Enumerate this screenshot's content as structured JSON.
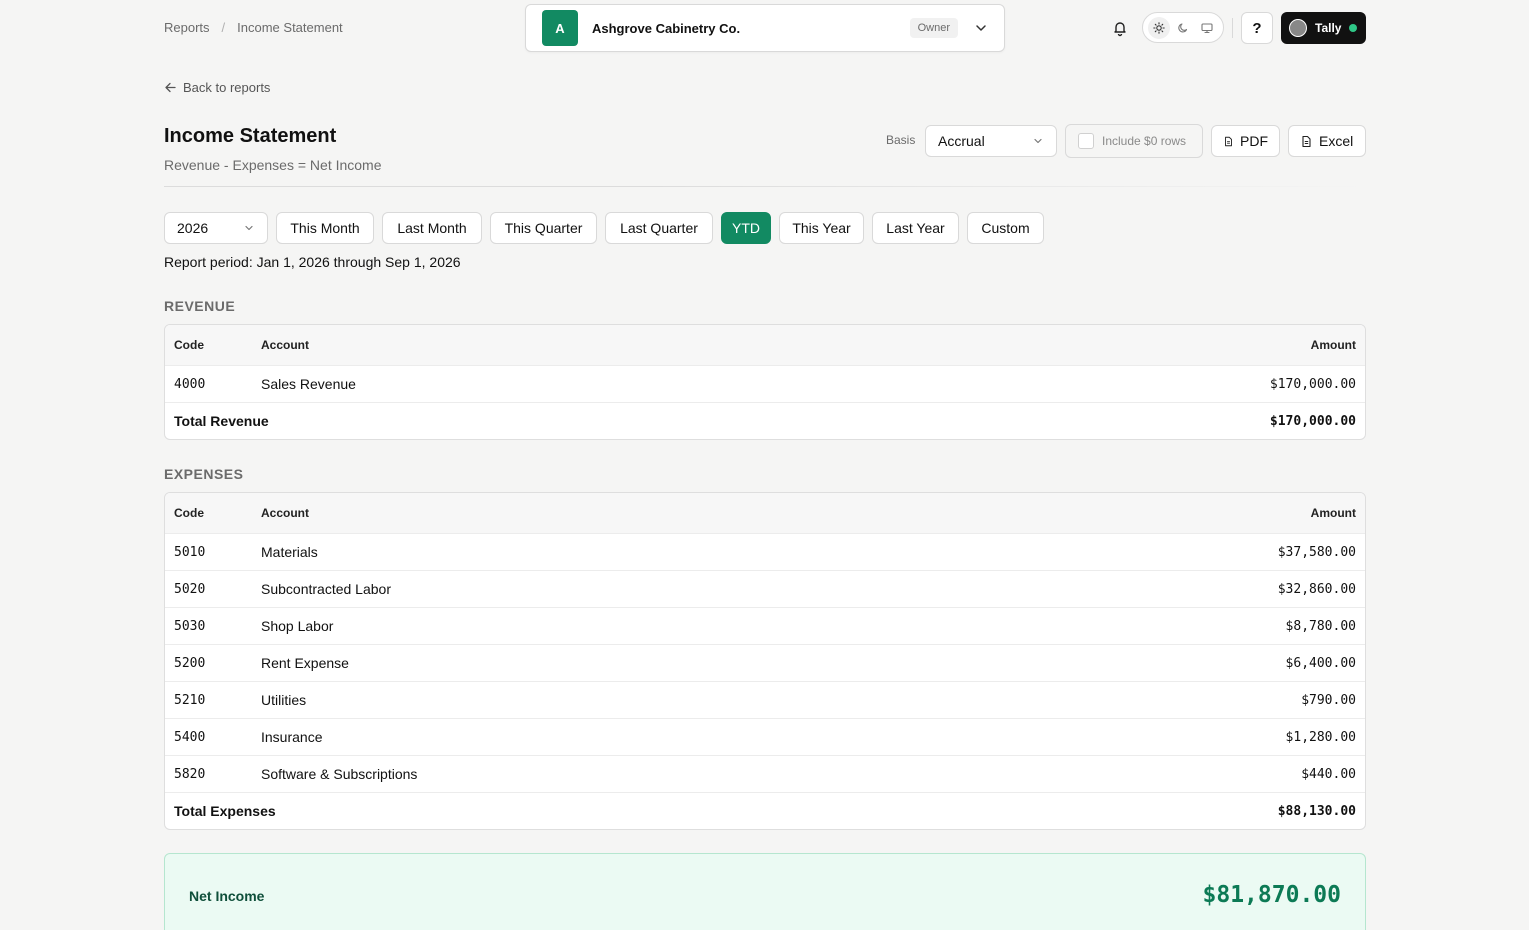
{
  "breadcrumb": {
    "root": "Reports",
    "separator": "/",
    "current": "Income Statement"
  },
  "org": {
    "initial": "A",
    "name": "Ashgrove Cabinetry Co.",
    "role": "Owner"
  },
  "user": {
    "name": "Tally",
    "status_color": "#2fc787"
  },
  "help_label": "?",
  "back_label": "Back to reports",
  "page": {
    "title": "Income Statement",
    "subtitle": "Revenue - Expenses = Net Income"
  },
  "controls": {
    "basis_label": "Basis",
    "basis_value": "Accrual",
    "include_zero_label": "Include $0 rows",
    "include_zero_checked": false,
    "pdf_label": "PDF",
    "excel_label": "Excel"
  },
  "period": {
    "year": "2026",
    "buttons": [
      "This Month",
      "Last Month",
      "This Quarter",
      "Last Quarter",
      "YTD",
      "This Year",
      "Last Year",
      "Custom"
    ],
    "active": "YTD",
    "report_period_text": "Report period: Jan 1, 2026 through Sep 1, 2026"
  },
  "revenue": {
    "title": "REVENUE",
    "columns": {
      "code": "Code",
      "account": "Account",
      "amount": "Amount"
    },
    "rows": [
      {
        "code": "4000",
        "account": "Sales Revenue",
        "amount": "$170,000.00"
      }
    ],
    "total_label": "Total Revenue",
    "total_amount": "$170,000.00"
  },
  "expenses": {
    "title": "EXPENSES",
    "columns": {
      "code": "Code",
      "account": "Account",
      "amount": "Amount"
    },
    "rows": [
      {
        "code": "5010",
        "account": "Materials",
        "amount": "$37,580.00"
      },
      {
        "code": "5020",
        "account": "Subcontracted Labor",
        "amount": "$32,860.00"
      },
      {
        "code": "5030",
        "account": "Shop Labor",
        "amount": "$8,780.00"
      },
      {
        "code": "5200",
        "account": "Rent Expense",
        "amount": "$6,400.00"
      },
      {
        "code": "5210",
        "account": "Utilities",
        "amount": "$790.00"
      },
      {
        "code": "5400",
        "account": "Insurance",
        "amount": "$1,280.00"
      },
      {
        "code": "5820",
        "account": "Software & Subscriptions",
        "amount": "$440.00"
      }
    ],
    "total_label": "Total Expenses",
    "total_amount": "$88,130.00"
  },
  "net_income": {
    "label": "Net Income",
    "amount": "$81,870.00"
  },
  "colors": {
    "accent": "#128a62",
    "net_bg": "#ebfaf3",
    "net_value": "#0c7a55"
  },
  "icons": [
    "chevron-down-icon",
    "bell-icon",
    "sun-icon",
    "moon-icon",
    "monitor-icon",
    "arrow-left-icon",
    "document-icon"
  ]
}
